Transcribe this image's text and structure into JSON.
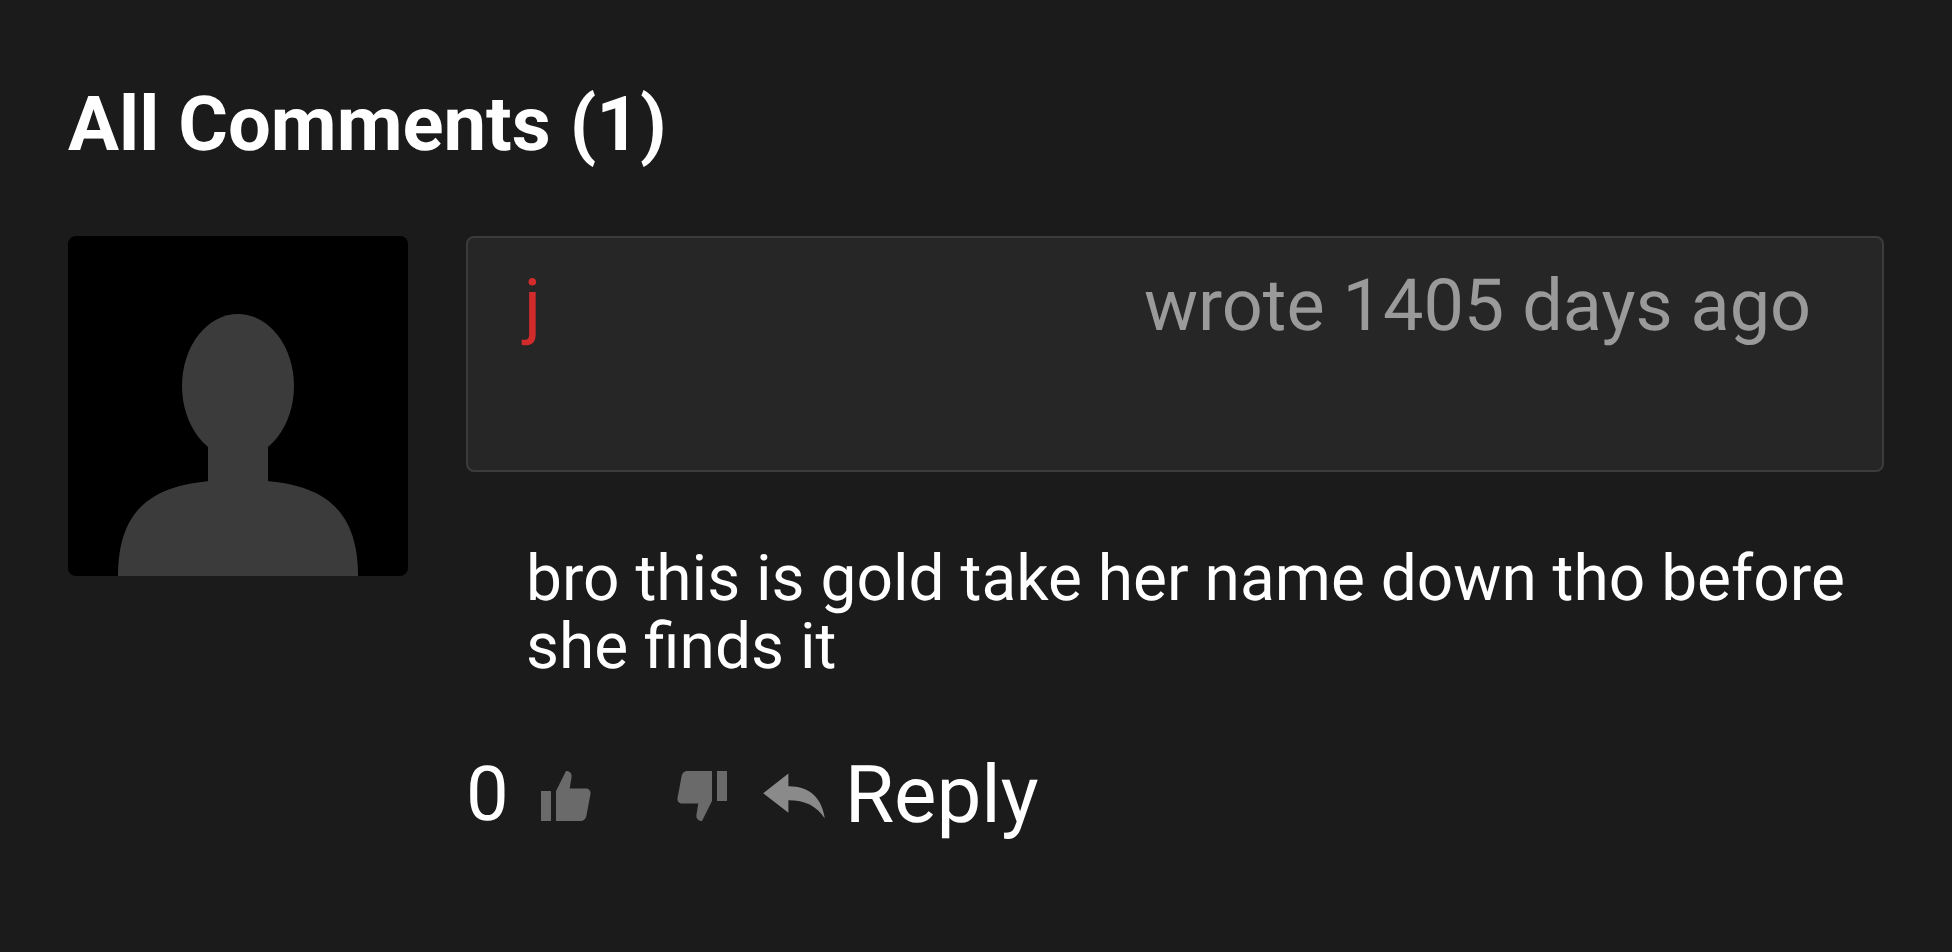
{
  "title": "All Comments (1)",
  "comments": [
    {
      "author": "j",
      "meta": "wrote 1405 days ago",
      "text": "bro this is gold take her name down tho before she finds it",
      "votes": "0",
      "reply": "Reply"
    }
  ]
}
